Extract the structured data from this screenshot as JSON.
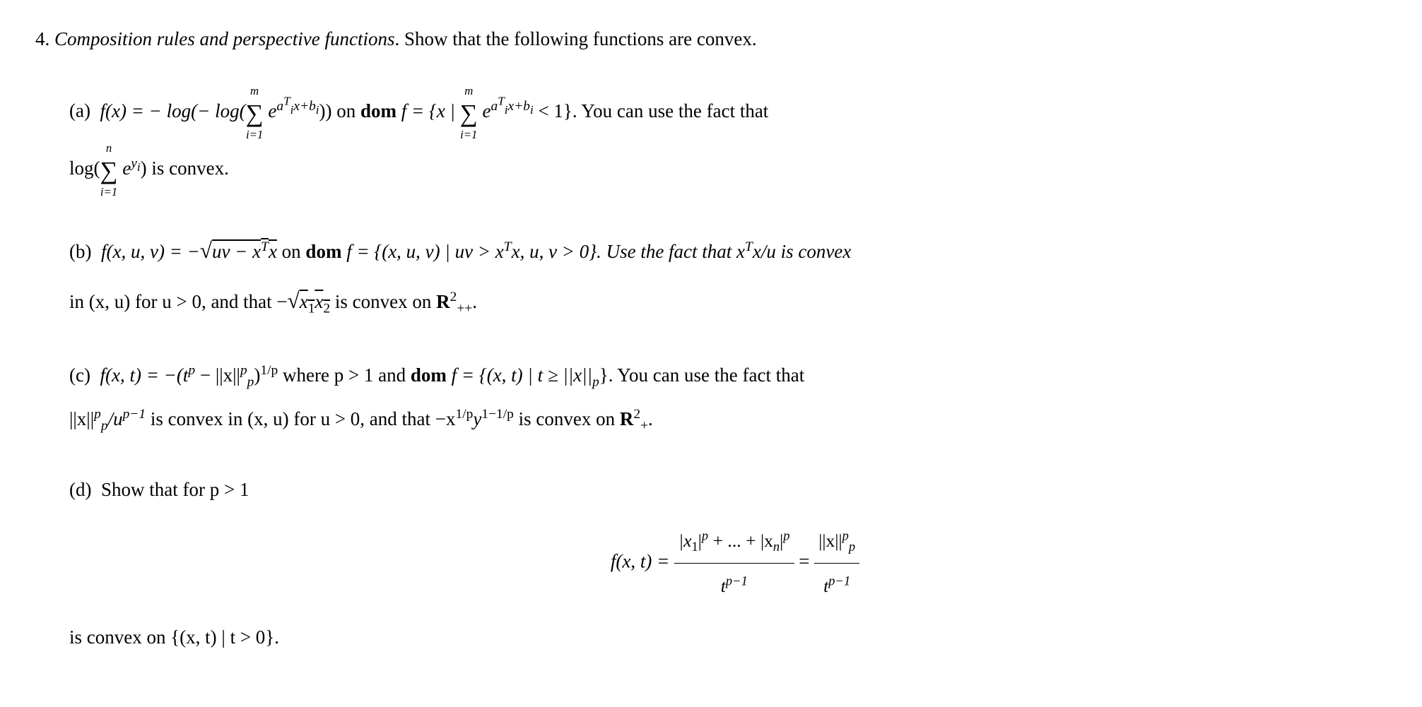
{
  "problem": {
    "number": "4.",
    "title_italic": "Composition rules and perspective functions",
    "title_rest": ". Show that the following functions are convex."
  },
  "parts": {
    "a": {
      "label": "(a)",
      "eq_lead": "f(x) = − log(− log(",
      "sum1_top": "m",
      "sum1_bot": "i=1",
      "exp1": "a",
      "exp1_sub": "i",
      "exp1_sup": "T",
      "exp1_tail": "x+b",
      "exp1_tail_sub": "i",
      "eq_mid": ")) on ",
      "dom": "dom",
      "eq_mid2": " f = {x | ",
      "sum2_top": "m",
      "sum2_bot": "i=1",
      "lt": " < 1}.  You can use the fact that",
      "line2_lead": "log(",
      "sum3_top": "n",
      "sum3_bot": "i=1",
      "exp3": "y",
      "exp3_sub": "i",
      "line2_tail": ") is convex."
    },
    "b": {
      "label": "(b)",
      "eq": "f(x, u, v) = −",
      "sqrt_body": "uv − x",
      "sqrt_sup": "T",
      "sqrt_tail": "x",
      "on": " on ",
      "dom": "dom",
      "domset": " f = {(x, u, v) | uv > x",
      "domset_sup": "T",
      "domset_tail": "x, u, v > 0}. Use the fact that x",
      "fact_sup": "T",
      "fact_tail": "x/u is convex",
      "line2": "in (x, u) for u > 0, and that −",
      "sqrt2_body": "x",
      "sqrt2_sub1": "1",
      "sqrt2_mid": "x",
      "sqrt2_sub2": "2",
      "line2_tail": " is convex on ",
      "R": "R",
      "R_sup": "2",
      "R_sub": "++",
      "period": "."
    },
    "c": {
      "label": "(c)",
      "lead": "f(x, t) = −(t",
      "p1": "p",
      "mid1": " − ||x||",
      "pp_sub": "p",
      "pp_sup": "p",
      "mid2": ")",
      "exp_1p": "1/p",
      "where": " where p > 1 and ",
      "dom": "dom",
      "domset": " f = {(x, t) | t ≥ ||x||",
      "domset_sub": "p",
      "domtail": "}.  You can use the fact that",
      "line2_a": "||x||",
      "l2_sup": "p",
      "l2_sub": "p",
      "line2_b": "/u",
      "l2_exp": "p−1",
      "line2_c": " is convex in (x, u) for u > 0, and that −x",
      "l2_exp2": "1/p",
      "line2_d": "y",
      "l2_exp3": "1−1/p",
      "line2_e": " is convex on ",
      "R": "R",
      "R_sup": "2",
      "R_sub": "+",
      "period": "."
    },
    "d": {
      "label": "(d)",
      "lead": "Show that for p > 1",
      "disp_lead": "f(x, t) = ",
      "num": "|x",
      "num_sub1": "1",
      "num_mid": "|",
      "num_sup": "p",
      "num_plus": " + ... + |x",
      "num_subn": "n",
      "num_tail": "|",
      "den_t": "t",
      "den_exp": "p−1",
      "eq2": " = ",
      "num2": "||x||",
      "num2_sup": "p",
      "num2_sub": "p",
      "tail": "is convex on {(x, t) | t > 0}."
    }
  }
}
